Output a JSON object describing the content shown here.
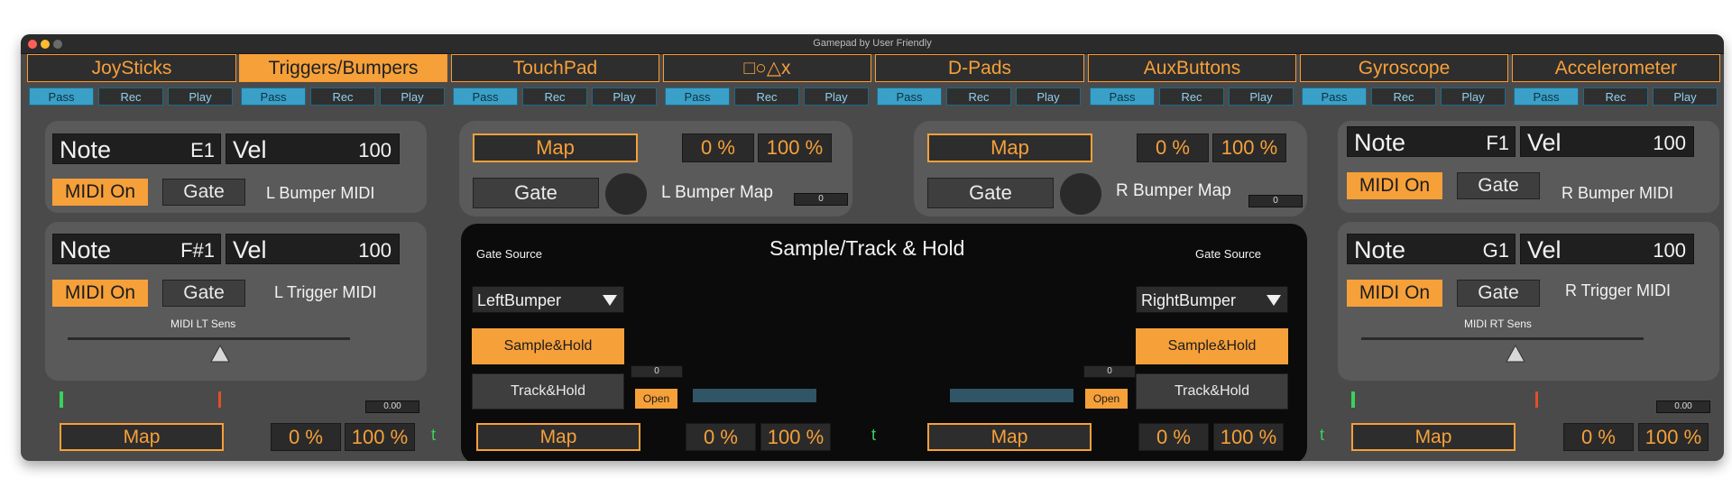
{
  "window": {
    "title": "Gamepad by User Friendly"
  },
  "tabs": [
    {
      "label": "JoySticks"
    },
    {
      "label": "Triggers/Bumpers"
    },
    {
      "label": "TouchPad"
    },
    {
      "label": "□○△x"
    },
    {
      "label": "D-Pads"
    },
    {
      "label": "AuxButtons"
    },
    {
      "label": "Gyroscope"
    },
    {
      "label": "Accelerometer"
    }
  ],
  "transport": {
    "pass": "Pass",
    "rec": "Rec",
    "play": "Play"
  },
  "left": {
    "bumper": {
      "note_label": "Note",
      "note": "E1",
      "vel_label": "Vel",
      "vel": "100",
      "midi_on": "MIDI On",
      "gate": "Gate",
      "caption": "L Bumper MIDI"
    },
    "trigger": {
      "note_label": "Note",
      "note": "F#1",
      "vel_label": "Vel",
      "vel": "100",
      "midi_on": "MIDI On",
      "gate": "Gate",
      "caption": "L Trigger MIDI",
      "sens": "MIDI LT Sens"
    },
    "small_value": "0.00",
    "map": "Map",
    "min": "0 %",
    "max": "100 %",
    "t": "t"
  },
  "right": {
    "bumper": {
      "note_label": "Note",
      "note": "F1",
      "vel_label": "Vel",
      "vel": "100",
      "midi_on": "MIDI On",
      "gate": "Gate",
      "caption": "R Bumper MIDI"
    },
    "trigger": {
      "note_label": "Note",
      "note": "G1",
      "vel_label": "Vel",
      "vel": "100",
      "midi_on": "MIDI On",
      "gate": "Gate",
      "caption": "R Trigger MIDI",
      "sens": "MIDI RT Sens"
    },
    "small_value": "0.00",
    "map": "Map",
    "min": "0 %",
    "max": "100 %",
    "t": "t"
  },
  "lbumpmap": {
    "map": "Map",
    "min": "0 %",
    "max": "100 %",
    "gate": "Gate",
    "caption": "L Bumper Map",
    "value": "0"
  },
  "rbumpmap": {
    "map": "Map",
    "min": "0 %",
    "max": "100 %",
    "gate": "Gate",
    "caption": "R Bumper Map",
    "value": "0"
  },
  "sh": {
    "title": "Sample/Track & Hold",
    "left": {
      "gate_source_label": "Gate Source",
      "source": "LeftBumper",
      "sample_hold": "Sample&Hold",
      "track_hold": "Track&Hold",
      "value": "0",
      "open": "Open",
      "map": "Map",
      "min": "0 %",
      "max": "100 %",
      "t": "t"
    },
    "right": {
      "gate_source_label": "Gate Source",
      "source": "RightBumper",
      "sample_hold": "Sample&Hold",
      "track_hold": "Track&Hold",
      "value": "0",
      "open": "Open",
      "map": "Map",
      "min": "0 %",
      "max": "100 %",
      "t": "t"
    }
  }
}
